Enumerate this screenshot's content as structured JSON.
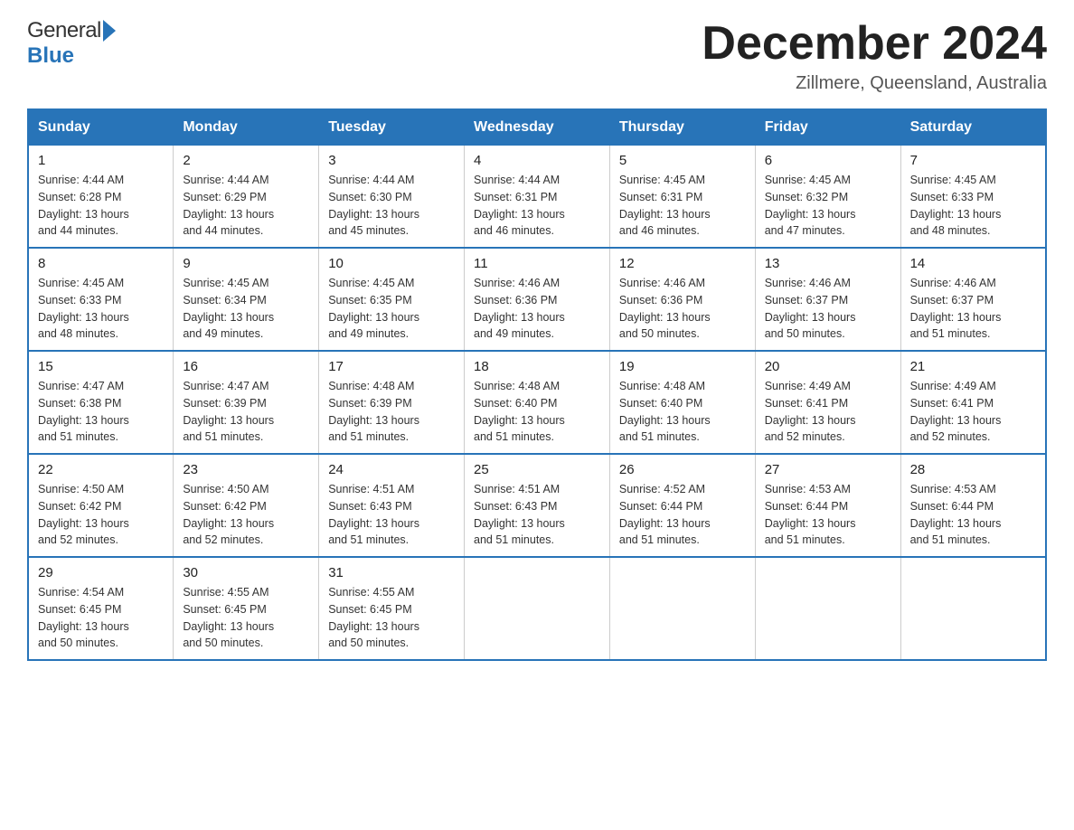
{
  "header": {
    "logo_general": "General",
    "logo_blue": "Blue",
    "month_title": "December 2024",
    "subtitle": "Zillmere, Queensland, Australia"
  },
  "weekdays": [
    "Sunday",
    "Monday",
    "Tuesday",
    "Wednesday",
    "Thursday",
    "Friday",
    "Saturday"
  ],
  "weeks": [
    [
      {
        "day": "1",
        "info": "Sunrise: 4:44 AM\nSunset: 6:28 PM\nDaylight: 13 hours\nand 44 minutes."
      },
      {
        "day": "2",
        "info": "Sunrise: 4:44 AM\nSunset: 6:29 PM\nDaylight: 13 hours\nand 44 minutes."
      },
      {
        "day": "3",
        "info": "Sunrise: 4:44 AM\nSunset: 6:30 PM\nDaylight: 13 hours\nand 45 minutes."
      },
      {
        "day": "4",
        "info": "Sunrise: 4:44 AM\nSunset: 6:31 PM\nDaylight: 13 hours\nand 46 minutes."
      },
      {
        "day": "5",
        "info": "Sunrise: 4:45 AM\nSunset: 6:31 PM\nDaylight: 13 hours\nand 46 minutes."
      },
      {
        "day": "6",
        "info": "Sunrise: 4:45 AM\nSunset: 6:32 PM\nDaylight: 13 hours\nand 47 minutes."
      },
      {
        "day": "7",
        "info": "Sunrise: 4:45 AM\nSunset: 6:33 PM\nDaylight: 13 hours\nand 48 minutes."
      }
    ],
    [
      {
        "day": "8",
        "info": "Sunrise: 4:45 AM\nSunset: 6:33 PM\nDaylight: 13 hours\nand 48 minutes."
      },
      {
        "day": "9",
        "info": "Sunrise: 4:45 AM\nSunset: 6:34 PM\nDaylight: 13 hours\nand 49 minutes."
      },
      {
        "day": "10",
        "info": "Sunrise: 4:45 AM\nSunset: 6:35 PM\nDaylight: 13 hours\nand 49 minutes."
      },
      {
        "day": "11",
        "info": "Sunrise: 4:46 AM\nSunset: 6:36 PM\nDaylight: 13 hours\nand 49 minutes."
      },
      {
        "day": "12",
        "info": "Sunrise: 4:46 AM\nSunset: 6:36 PM\nDaylight: 13 hours\nand 50 minutes."
      },
      {
        "day": "13",
        "info": "Sunrise: 4:46 AM\nSunset: 6:37 PM\nDaylight: 13 hours\nand 50 minutes."
      },
      {
        "day": "14",
        "info": "Sunrise: 4:46 AM\nSunset: 6:37 PM\nDaylight: 13 hours\nand 51 minutes."
      }
    ],
    [
      {
        "day": "15",
        "info": "Sunrise: 4:47 AM\nSunset: 6:38 PM\nDaylight: 13 hours\nand 51 minutes."
      },
      {
        "day": "16",
        "info": "Sunrise: 4:47 AM\nSunset: 6:39 PM\nDaylight: 13 hours\nand 51 minutes."
      },
      {
        "day": "17",
        "info": "Sunrise: 4:48 AM\nSunset: 6:39 PM\nDaylight: 13 hours\nand 51 minutes."
      },
      {
        "day": "18",
        "info": "Sunrise: 4:48 AM\nSunset: 6:40 PM\nDaylight: 13 hours\nand 51 minutes."
      },
      {
        "day": "19",
        "info": "Sunrise: 4:48 AM\nSunset: 6:40 PM\nDaylight: 13 hours\nand 51 minutes."
      },
      {
        "day": "20",
        "info": "Sunrise: 4:49 AM\nSunset: 6:41 PM\nDaylight: 13 hours\nand 52 minutes."
      },
      {
        "day": "21",
        "info": "Sunrise: 4:49 AM\nSunset: 6:41 PM\nDaylight: 13 hours\nand 52 minutes."
      }
    ],
    [
      {
        "day": "22",
        "info": "Sunrise: 4:50 AM\nSunset: 6:42 PM\nDaylight: 13 hours\nand 52 minutes."
      },
      {
        "day": "23",
        "info": "Sunrise: 4:50 AM\nSunset: 6:42 PM\nDaylight: 13 hours\nand 52 minutes."
      },
      {
        "day": "24",
        "info": "Sunrise: 4:51 AM\nSunset: 6:43 PM\nDaylight: 13 hours\nand 51 minutes."
      },
      {
        "day": "25",
        "info": "Sunrise: 4:51 AM\nSunset: 6:43 PM\nDaylight: 13 hours\nand 51 minutes."
      },
      {
        "day": "26",
        "info": "Sunrise: 4:52 AM\nSunset: 6:44 PM\nDaylight: 13 hours\nand 51 minutes."
      },
      {
        "day": "27",
        "info": "Sunrise: 4:53 AM\nSunset: 6:44 PM\nDaylight: 13 hours\nand 51 minutes."
      },
      {
        "day": "28",
        "info": "Sunrise: 4:53 AM\nSunset: 6:44 PM\nDaylight: 13 hours\nand 51 minutes."
      }
    ],
    [
      {
        "day": "29",
        "info": "Sunrise: 4:54 AM\nSunset: 6:45 PM\nDaylight: 13 hours\nand 50 minutes."
      },
      {
        "day": "30",
        "info": "Sunrise: 4:55 AM\nSunset: 6:45 PM\nDaylight: 13 hours\nand 50 minutes."
      },
      {
        "day": "31",
        "info": "Sunrise: 4:55 AM\nSunset: 6:45 PM\nDaylight: 13 hours\nand 50 minutes."
      },
      null,
      null,
      null,
      null
    ]
  ]
}
